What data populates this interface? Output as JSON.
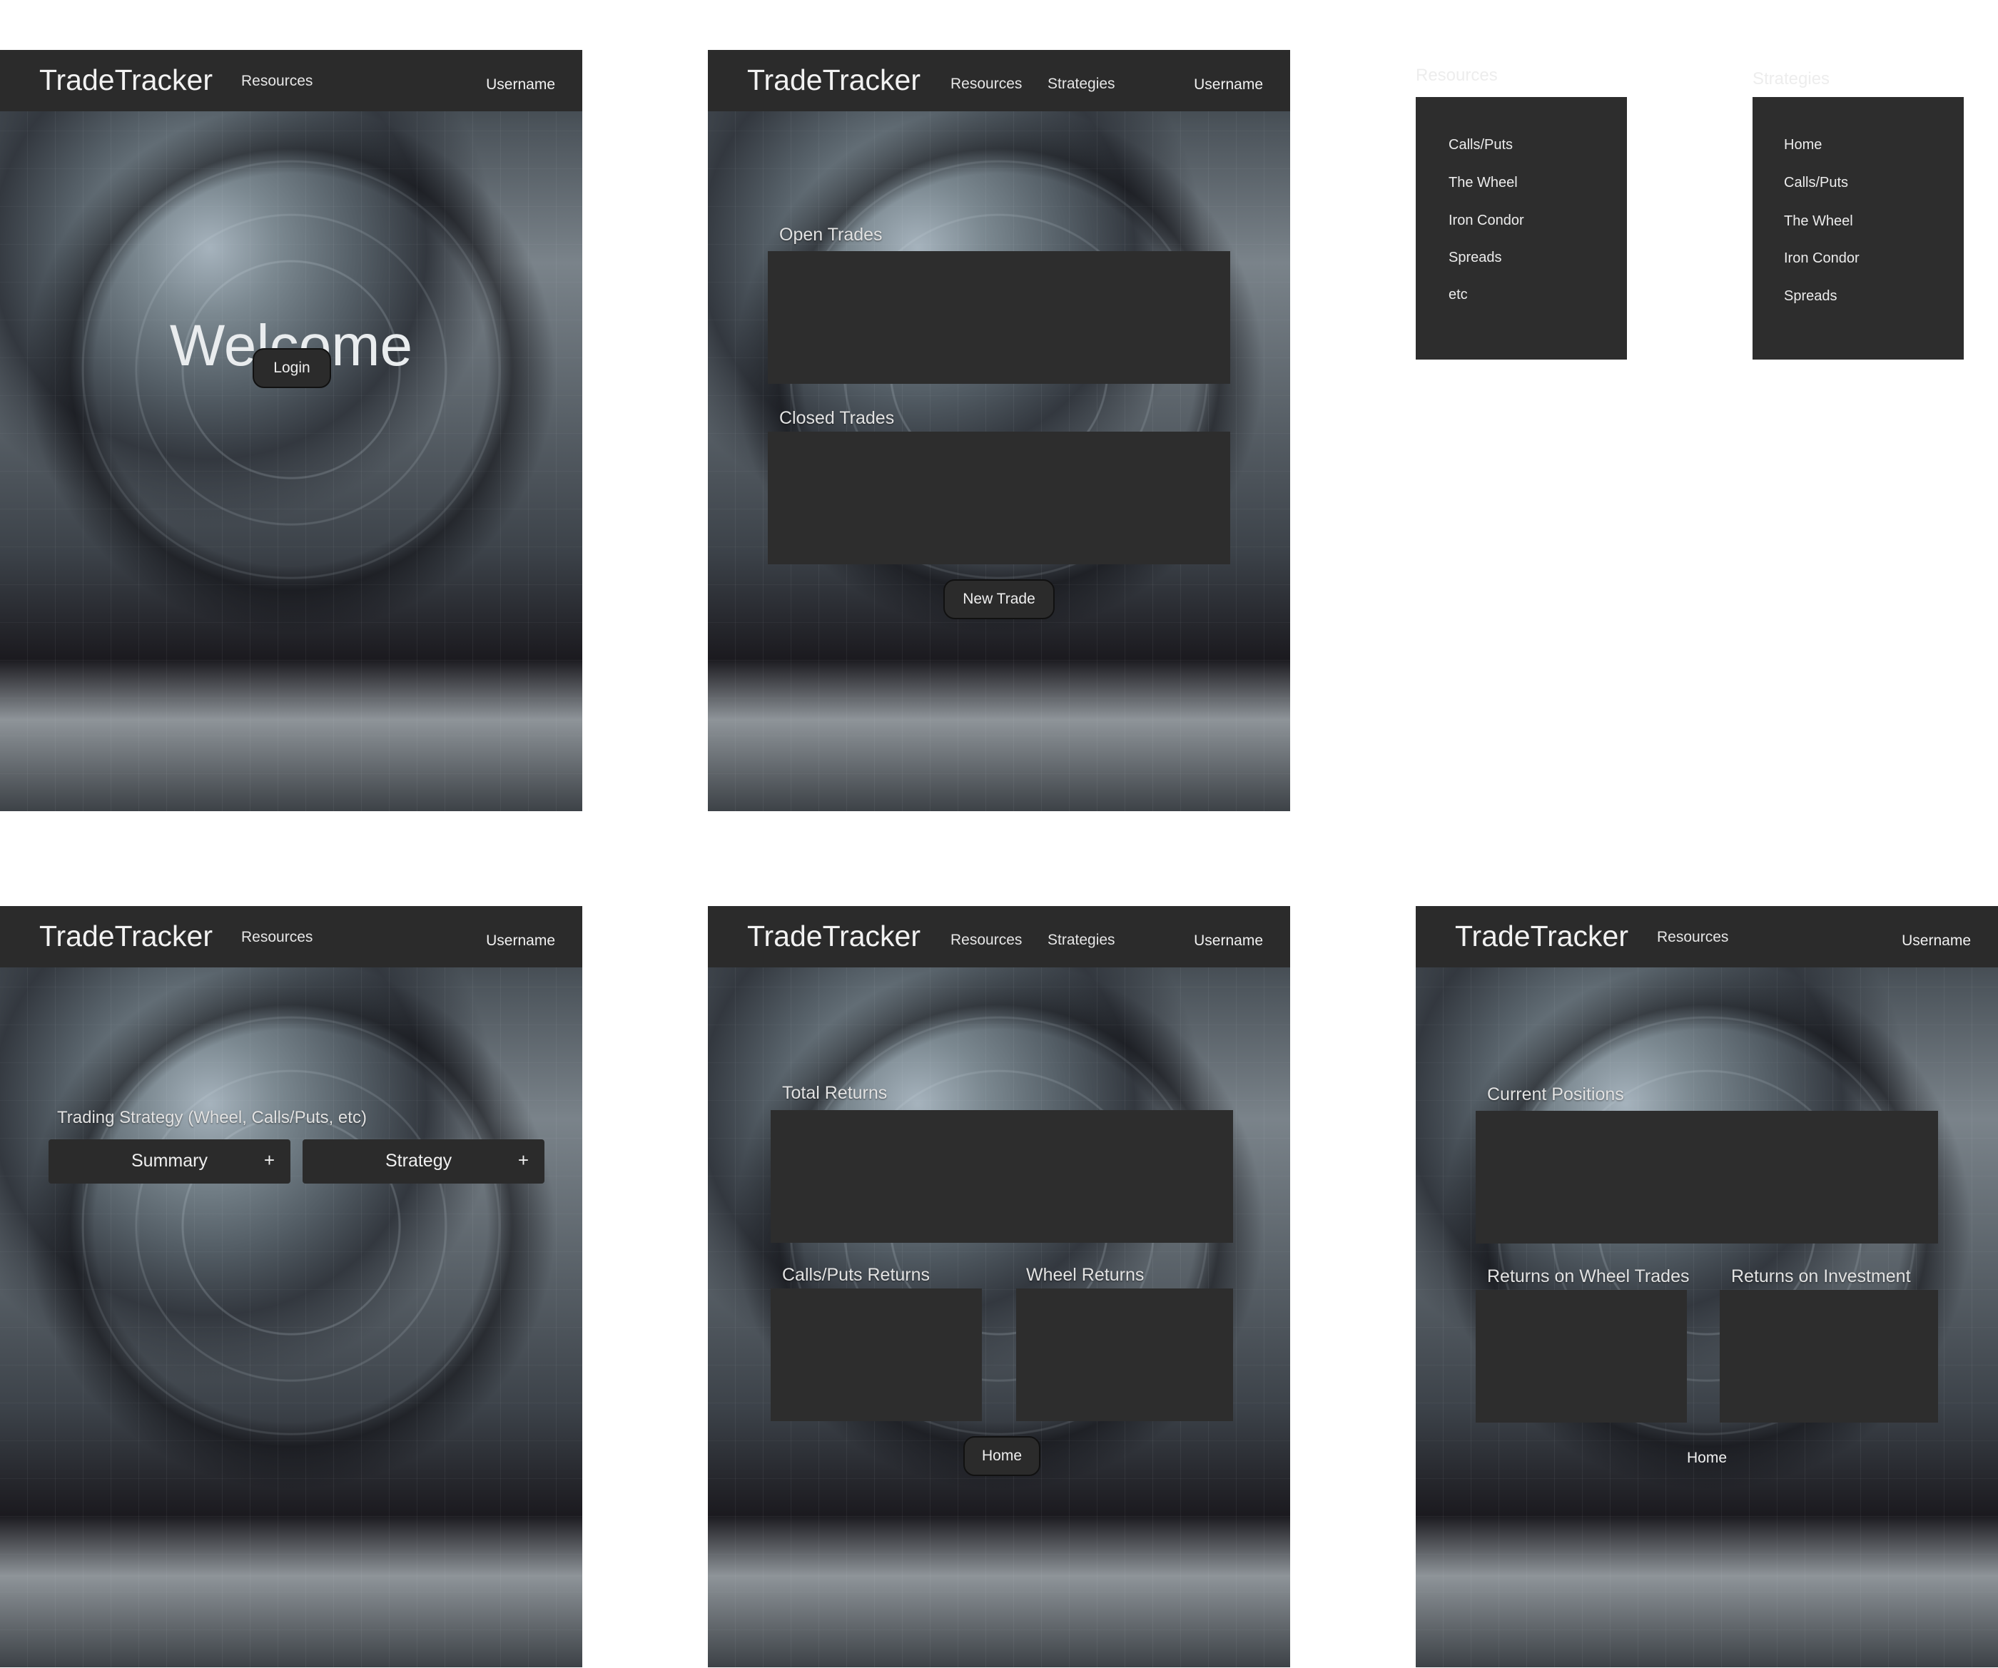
{
  "brand": "TradeTracker",
  "nav": {
    "resources": "Resources",
    "strategies": "Strategies",
    "username": "Username"
  },
  "login_screen": {
    "title": "Welcome",
    "login_button": "Login"
  },
  "trades_screen": {
    "open_trades": "Open Trades",
    "closed_trades": "Closed Trades",
    "new_trade_button": "New Trade"
  },
  "resources_dropdown": {
    "title": "Resources",
    "items": [
      "Calls/Puts",
      "The Wheel",
      "Iron Condor",
      "Spreads",
      "etc"
    ]
  },
  "strategies_dropdown": {
    "title": "Strategies",
    "items": [
      "Home",
      "Calls/Puts",
      "The Wheel",
      "Iron Condor",
      "Spreads"
    ]
  },
  "strategy_screen": {
    "label": "Trading Strategy (Wheel, Calls/Puts, etc)",
    "summary": "Summary",
    "strategy": "Strategy",
    "plus": "+"
  },
  "returns_screen": {
    "total_returns": "Total Returns",
    "calls_puts_returns": "Calls/Puts Returns",
    "wheel_returns": "Wheel Returns",
    "home_button": "Home"
  },
  "positions_screen": {
    "current_positions": "Current Positions",
    "wheel_trades": "Returns on Wheel Trades",
    "roi": "Returns on Investment",
    "home_link": "Home"
  }
}
